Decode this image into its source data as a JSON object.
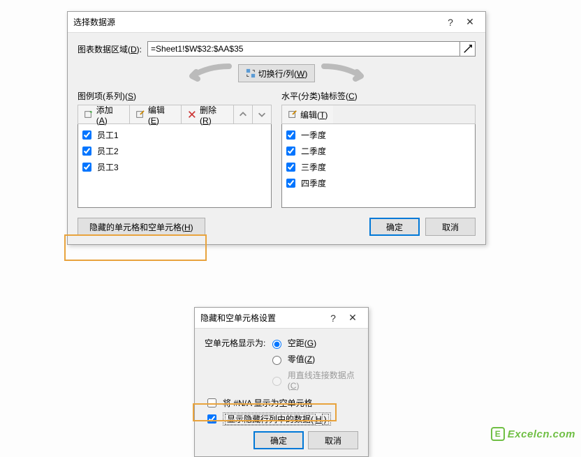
{
  "dialog1": {
    "title": "选择数据源",
    "help": "?",
    "close": "✕",
    "range_label_pre": "图表数据区域(",
    "range_label_u": "D",
    "range_label_post": "):",
    "range_value": "=Sheet1!$W$32:$AA$35",
    "swap_label_pre": "切换行/列(",
    "swap_label_u": "W",
    "swap_label_post": ")",
    "legend_label_pre": "图例项(系列)(",
    "legend_label_u": "S",
    "legend_label_post": ")",
    "legend_toolbar": {
      "add_pre": "添加(",
      "add_u": "A",
      "add_post": ")",
      "edit_pre": "编辑(",
      "edit_u": "E",
      "edit_post": ")",
      "remove_pre": "删除(",
      "remove_u": "R",
      "remove_post": ")"
    },
    "legend_items": [
      "员工1",
      "员工2",
      "员工3"
    ],
    "axis_label_pre": "水平(分类)轴标签(",
    "axis_label_u": "C",
    "axis_label_post": ")",
    "axis_toolbar": {
      "edit_pre": "编辑(",
      "edit_u": "T",
      "edit_post": ")"
    },
    "axis_items": [
      "一季度",
      "二季度",
      "三季度",
      "四季度"
    ],
    "hidden_btn_pre": "隐藏的单元格和空单元格(",
    "hidden_btn_u": "H",
    "hidden_btn_post": ")",
    "ok": "确定",
    "cancel": "取消"
  },
  "dialog2": {
    "title": "隐藏和空单元格设置",
    "help": "?",
    "close": "✕",
    "empty_label": "空单元格显示为:",
    "radios": {
      "gap_pre": "空距(",
      "gap_u": "G",
      "gap_post": ")",
      "zero_pre": "零值(",
      "zero_u": "Z",
      "zero_post": ")",
      "line_pre": "用直线连接数据点(",
      "line_u": "C",
      "line_post": ")"
    },
    "chk_na": "将 #N/A 显示为空单元格",
    "chk_hidden_pre": "显示隐藏行列中的数据(",
    "chk_hidden_u": "H",
    "chk_hidden_post": ")",
    "ok": "确定",
    "cancel": "取消"
  },
  "watermark": "Excelcn.com"
}
